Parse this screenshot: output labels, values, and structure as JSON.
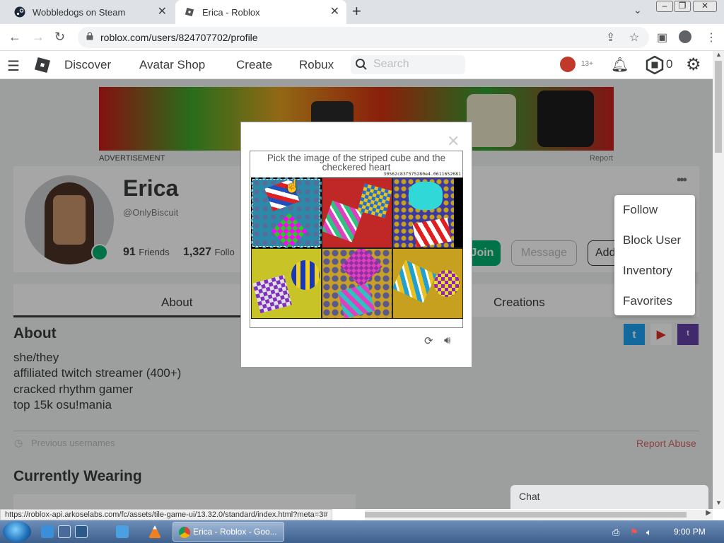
{
  "browser": {
    "tabs": [
      {
        "title": "Wobbledogs on Steam",
        "icon": "steam-icon"
      },
      {
        "title": "Erica - Roblox",
        "icon": "roblox-icon"
      }
    ],
    "url": "roblox.com/users/824707702/profile",
    "status_url": "https://roblox-api.arkoselabs.com/fc/assets/tile-game-ui/13.32.0/standard/index.html?meta=3#"
  },
  "roblox_nav": {
    "links": [
      "Discover",
      "Avatar Shop",
      "Create",
      "Robux"
    ],
    "search_placeholder": "Search",
    "age_badge": "13+",
    "robux_count": "0"
  },
  "ad": {
    "label": "ADVERTISEMENT",
    "report": "Report"
  },
  "profile": {
    "name": "Erica",
    "handle": "@OnlyBiscuit",
    "friends_count": "91",
    "friends_label": "Friends",
    "followers_count": "1,327",
    "followers_label": "Follo",
    "join_button": "Join",
    "message_button": "Message",
    "add_button": "Add",
    "more_icon": "ellipsis-icon"
  },
  "context_menu": [
    "Follow",
    "Block User",
    "Inventory",
    "Favorites"
  ],
  "tabs": [
    "About",
    "Creations"
  ],
  "about": {
    "heading": "About",
    "bio": [
      "she/they",
      "affiliated twitch streamer (400+)",
      "cracked rhythm gamer",
      "top 15k osu!mania"
    ],
    "previous_usernames": "Previous usernames",
    "report_abuse": "Report Abuse"
  },
  "currently_wearing": "Currently Wearing",
  "chat": "Chat",
  "captcha": {
    "prompt": "Pick the image of the striped cube and the checkered heart",
    "hash": "30562c83f575280e4.0611652681"
  },
  "taskbar": {
    "chrome_label": "Erica - Roblox - Goo...",
    "time": "9:00 PM"
  },
  "colors": {
    "join_green": "#00b06f",
    "report_red": "#d86868",
    "twitter_blue": "#1da1f2",
    "youtube_red": "#e52d27",
    "twitch_purple": "#6441a5"
  }
}
